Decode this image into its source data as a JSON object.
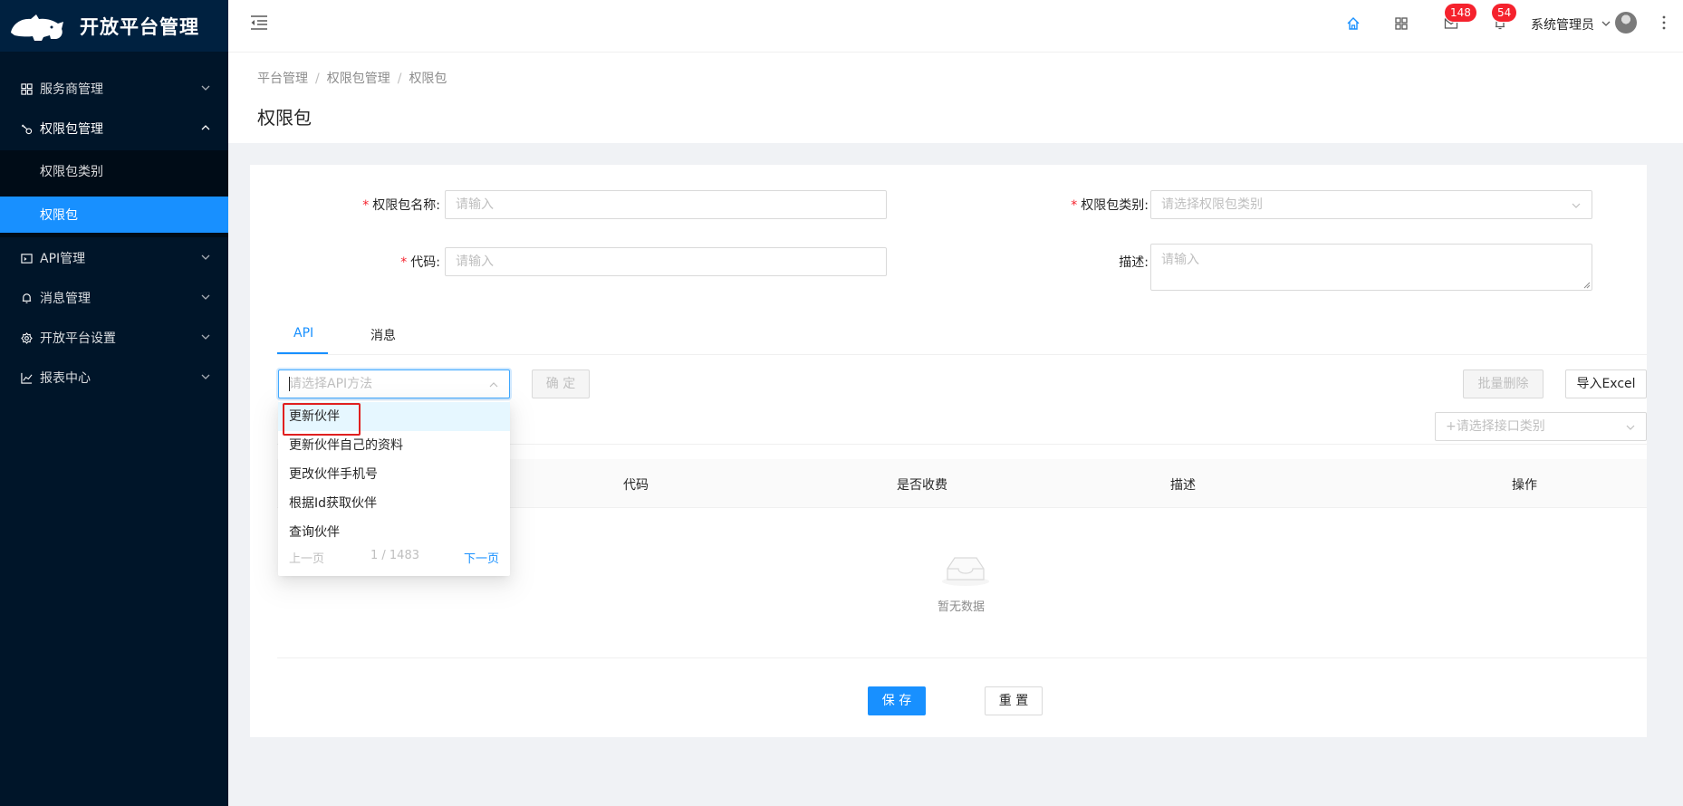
{
  "app": {
    "title": "开放平台管理"
  },
  "sidebar": {
    "items": [
      {
        "label": "服务商管理",
        "icon": "grid-icon"
      },
      {
        "label": "权限包管理",
        "icon": "key-icon"
      },
      {
        "label": "API管理",
        "icon": "api-icon"
      },
      {
        "label": "消息管理",
        "icon": "bell-icon"
      },
      {
        "label": "开放平台设置",
        "icon": "gear-icon"
      },
      {
        "label": "报表中心",
        "icon": "line-chart-icon"
      }
    ],
    "subitems": [
      {
        "label": "权限包类别"
      },
      {
        "label": "权限包"
      }
    ]
  },
  "header": {
    "mail_badge": "148",
    "bell_badge": "54",
    "user_name": "系统管理员"
  },
  "breadcrumb": [
    "平台管理",
    "权限包管理",
    "权限包"
  ],
  "page_title": "权限包",
  "form": {
    "name_label": "权限包名称:",
    "name_placeholder": "请输入",
    "type_label": "权限包类别:",
    "type_placeholder": "请选择权限包类别",
    "code_label": "代码:",
    "code_placeholder": "请输入",
    "desc_label": "描述:",
    "desc_placeholder": "请输入"
  },
  "tabs": [
    {
      "label": "API"
    },
    {
      "label": "消息"
    }
  ],
  "toolbar": {
    "api_placeholder": "请选择API方法",
    "confirm_label": "确 定",
    "batch_delete_label": "批量删除",
    "import_label": "导入Excel",
    "interface_type_placeholder": "+请选择接口类别"
  },
  "table": {
    "columns": [
      "代码",
      "是否收费",
      "描述",
      "操作"
    ],
    "empty_text": "暂无数据"
  },
  "dropdown": {
    "options": [
      "更新伙伴",
      "更新伙伴自己的资料",
      "更改伙伴手机号",
      "根据Id获取伙伴",
      "查询伙伴"
    ],
    "prev_label": "上一页",
    "page_info": "1 / 1483",
    "next_label": "下一页"
  },
  "footer": {
    "save_label": "保 存",
    "reset_label": "重 置"
  },
  "colors": {
    "primary": "#1890ff",
    "sidebar_bg": "#001529",
    "badge": "#f5222d",
    "highlight_box": "#e02020"
  }
}
